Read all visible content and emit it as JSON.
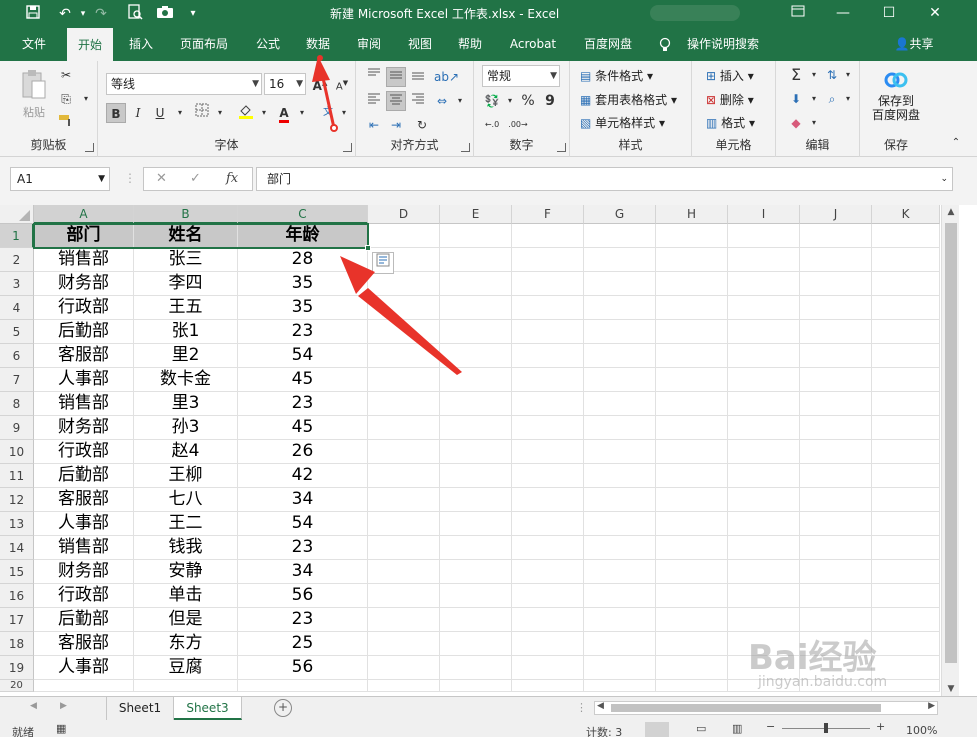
{
  "titlebar": {
    "title": "新建 Microsoft Excel 工作表.xlsx  -  Excel",
    "qa_icons": [
      "save-icon",
      "undo-icon",
      "redo-icon",
      "print-preview-icon",
      "camera-icon",
      "customize-icon"
    ],
    "window_controls": [
      "ribbon-display-icon",
      "minimize-icon",
      "maximize-icon",
      "close-icon"
    ]
  },
  "tabs": [
    "文件",
    "开始",
    "插入",
    "页面布局",
    "公式",
    "数据",
    "审阅",
    "视图",
    "帮助",
    "Acrobat",
    "百度网盘",
    "操作说明搜索"
  ],
  "active_tab": "开始",
  "share_label": "共享",
  "ribbon": {
    "clipboard": {
      "label": "剪贴板",
      "paste": "粘贴"
    },
    "font": {
      "label": "字体",
      "font_name": "等线",
      "font_size": "16",
      "bold": "B",
      "italic": "I",
      "underline": "U"
    },
    "alignment": {
      "label": "对齐方式"
    },
    "number": {
      "label": "数字",
      "format": "常规",
      "percent": "%",
      "comma": "9"
    },
    "styles": {
      "label": "样式",
      "items": [
        "条件格式",
        "套用表格格式",
        "单元格样式"
      ]
    },
    "cells": {
      "label": "单元格",
      "items": [
        "插入",
        "删除",
        "格式"
      ]
    },
    "editing": {
      "label": "编辑"
    },
    "save": {
      "label": "保存",
      "button": "保存到\n百度网盘",
      "line1": "保存到",
      "line2": "百度网盘"
    }
  },
  "formula_bar": {
    "name_box": "A1",
    "fx": "fx",
    "cancel": "✕",
    "enter": "✓",
    "content": "部门"
  },
  "columns": [
    "A",
    "B",
    "C",
    "D",
    "E",
    "F",
    "G",
    "H",
    "I",
    "J",
    "K"
  ],
  "rows": [
    "1",
    "2",
    "3",
    "4",
    "5",
    "6",
    "7",
    "8",
    "9",
    "10",
    "11",
    "12",
    "13",
    "14",
    "15",
    "16",
    "17",
    "18",
    "19",
    "20"
  ],
  "table": {
    "headers": [
      "部门",
      "姓名",
      "年龄"
    ],
    "data": [
      [
        "销售部",
        "张三",
        "28"
      ],
      [
        "财务部",
        "李四",
        "35"
      ],
      [
        "行政部",
        "王五",
        "35"
      ],
      [
        "后勤部",
        "张1",
        "23"
      ],
      [
        "客服部",
        "里2",
        "54"
      ],
      [
        "人事部",
        "数卡金",
        "45"
      ],
      [
        "销售部",
        "里3",
        "23"
      ],
      [
        "财务部",
        "孙3",
        "45"
      ],
      [
        "行政部",
        "赵4",
        "26"
      ],
      [
        "后勤部",
        "王柳",
        "42"
      ],
      [
        "客服部",
        "七八",
        "34"
      ],
      [
        "人事部",
        "王二",
        "54"
      ],
      [
        "销售部",
        "钱我",
        "23"
      ],
      [
        "财务部",
        "安静",
        "34"
      ],
      [
        "行政部",
        "单击",
        "56"
      ],
      [
        "后勤部",
        "但是",
        "23"
      ],
      [
        "客服部",
        "东方",
        "25"
      ],
      [
        "人事部",
        "豆腐",
        "56"
      ]
    ]
  },
  "sheets": [
    "Sheet1",
    "Sheet3"
  ],
  "active_sheet": "Sheet3",
  "status": {
    "mode": "就绪",
    "count": "计数: 3",
    "zoom": "100%"
  },
  "watermark": {
    "brand": "Bai经验",
    "url": "jingyan.baidu.com"
  },
  "colors": {
    "excel_green": "#217346",
    "arrow_red": "#e8332a",
    "header_fill": "#c8c8c8"
  }
}
